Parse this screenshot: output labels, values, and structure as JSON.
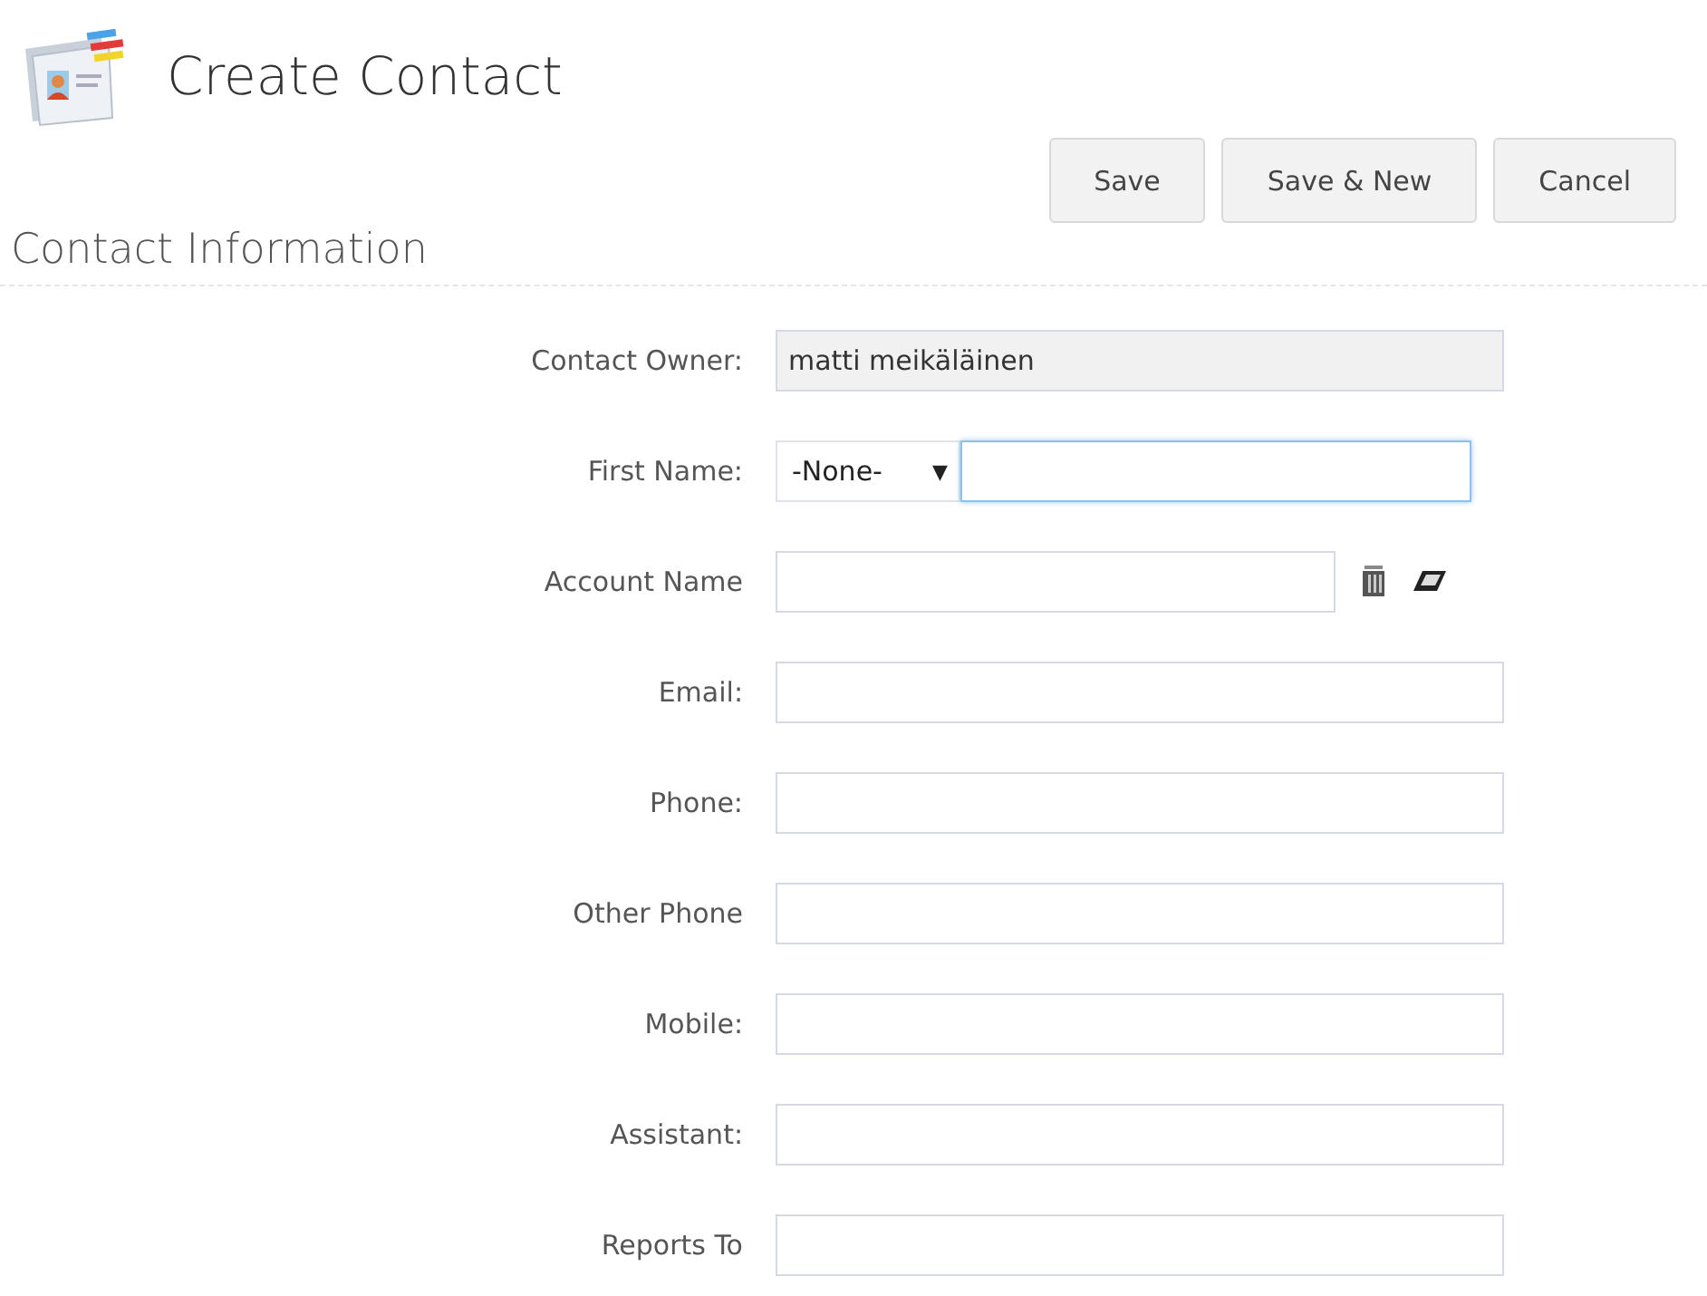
{
  "header": {
    "title": "Create Contact"
  },
  "buttons": [
    "Save",
    "Save & New",
    "Cancel"
  ],
  "section": {
    "title": "Contact Information"
  },
  "fields": [
    {
      "kind": "readonly",
      "label": "Contact Owner:",
      "value": "matti meikäläinen"
    },
    {
      "kind": "salutation",
      "label": "First Name:",
      "select": "-None-",
      "caret": "▼",
      "focused": true
    },
    {
      "kind": "lookup",
      "label": "Account Name"
    },
    {
      "kind": "text",
      "label": "Email:"
    },
    {
      "kind": "text",
      "label": "Phone:"
    },
    {
      "kind": "text",
      "label": "Other Phone"
    },
    {
      "kind": "text",
      "label": "Mobile:"
    },
    {
      "kind": "text",
      "label": "Assistant:"
    },
    {
      "kind": "text",
      "label": "Reports To"
    }
  ]
}
